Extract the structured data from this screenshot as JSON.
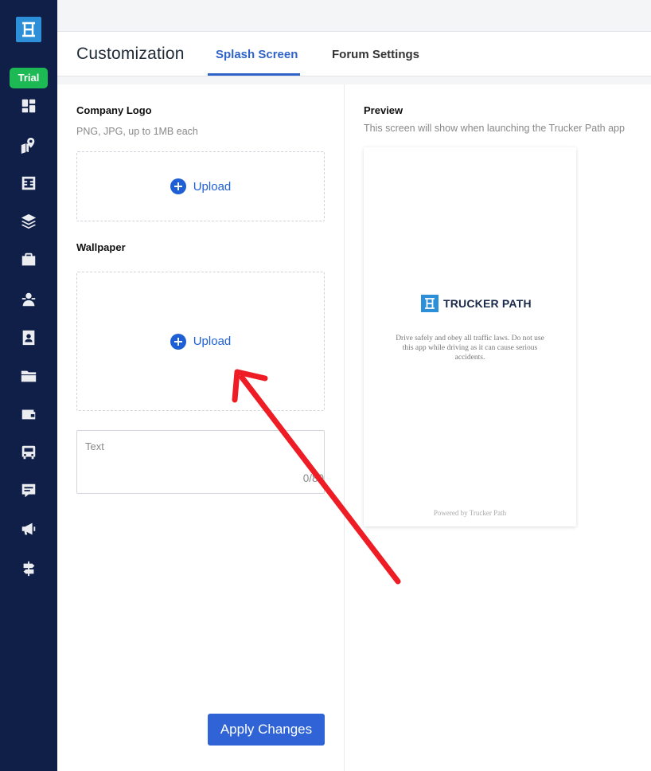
{
  "sidebar": {
    "badge": "Trial",
    "items": [
      {
        "icon": "dashboard-icon"
      },
      {
        "icon": "map-pin-icon"
      },
      {
        "icon": "logo-grid-icon"
      },
      {
        "icon": "layers-icon"
      },
      {
        "icon": "briefcase-icon"
      },
      {
        "icon": "driver-icon"
      },
      {
        "icon": "contact-card-icon"
      },
      {
        "icon": "folder-icon"
      },
      {
        "icon": "wallet-icon"
      },
      {
        "icon": "truck-icon"
      },
      {
        "icon": "message-icon"
      },
      {
        "icon": "megaphone-icon"
      },
      {
        "icon": "signpost-icon"
      }
    ]
  },
  "header": {
    "title": "Customization",
    "tabs": [
      {
        "label": "Splash Screen",
        "active": true
      },
      {
        "label": "Forum Settings",
        "active": false
      }
    ]
  },
  "form": {
    "company_logo_label": "Company Logo",
    "company_logo_hint": "PNG, JPG, up to 1MB each",
    "logo_upload_label": "Upload",
    "wallpaper_label": "Wallpaper",
    "wallpaper_upload_label": "Upload",
    "text_placeholder": "Text",
    "text_counter": "0/80",
    "apply_button": "Apply Changes"
  },
  "preview": {
    "title": "Preview",
    "description": "This screen will show when launching the Trucker Path app",
    "brand_name": "TRUCKER PATH",
    "disclaimer": "Drive safely and obey all traffic laws. Do not use this app while driving as it can cause serious accidents.",
    "powered_by": "Powered by Trucker Path"
  },
  "colors": {
    "sidebar_bg": "#0f1f47",
    "accent": "#2f63d6",
    "trial_badge": "#1db954",
    "annotation_arrow": "#ee1c24"
  }
}
